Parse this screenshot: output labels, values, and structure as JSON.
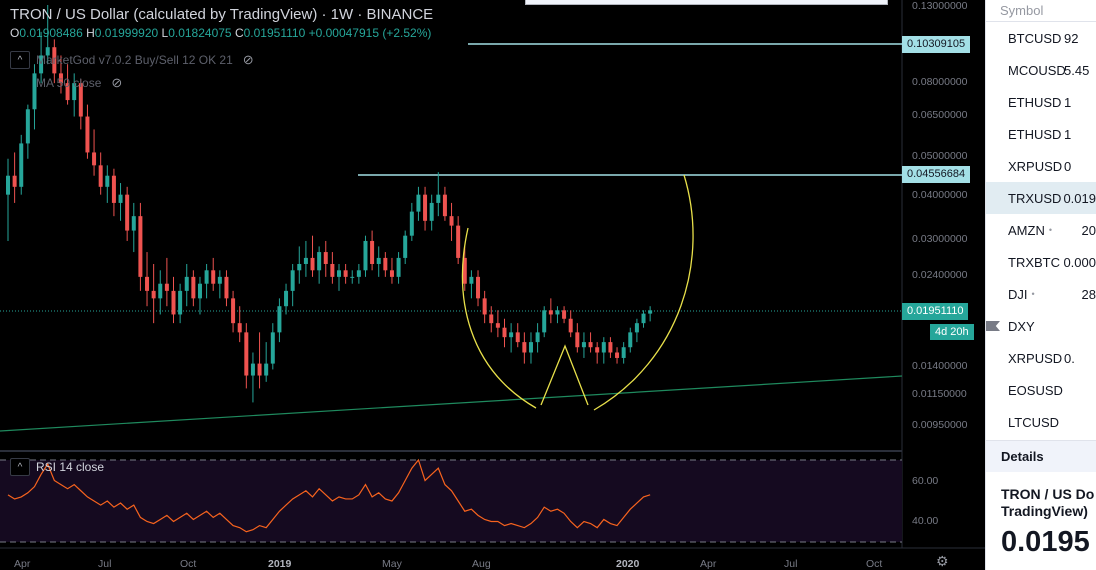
{
  "header": {
    "title": "TRON / US Dollar (calculated by TradingView) · 1W · BINANCE",
    "ohlc": [
      {
        "k": "O",
        "v": "0.01908486"
      },
      {
        "k": "H",
        "v": "0.01999920"
      },
      {
        "k": "L",
        "v": "0.01824075"
      },
      {
        "k": "C",
        "v": "0.01951110"
      },
      {
        "k": "",
        "v": "+0.00047915 (+2.52%)"
      }
    ]
  },
  "indicators": {
    "marketgod": "MarketGod v7.0.2 Buy/Sell 12 OK 21",
    "ma": "MA 50 close",
    "rsi": "RSI 14 close",
    "toggle": "^"
  },
  "price_axis": {
    "labels": [
      "0.13000000",
      "0.08000000",
      "0.06500000",
      "0.05000000",
      "0.04000000",
      "0.03000000",
      "0.02400000",
      "0.01400000",
      "0.01150000",
      "0.00950000"
    ],
    "line_tag_top": "0.10309105",
    "line_tag_mid": "0.04556684",
    "current_price": "0.01951110",
    "countdown": "4d 20h"
  },
  "rsi_axis": [
    "60.00",
    "40.00"
  ],
  "time_axis": [
    "Apr",
    "Jul",
    "Oct",
    "2019",
    "May",
    "Aug",
    "2020",
    "Apr",
    "Jul",
    "Oct"
  ],
  "chart_data": {
    "type": "candlestick",
    "symbol": "TRXUSD",
    "interval": "1W",
    "up_color": "#26a69a",
    "down_color": "#ef5350",
    "candles": [
      [
        0.04,
        0.05,
        0.03,
        0.045
      ],
      [
        0.045,
        0.052,
        0.038,
        0.042
      ],
      [
        0.042,
        0.058,
        0.04,
        0.055
      ],
      [
        0.055,
        0.07,
        0.05,
        0.068
      ],
      [
        0.068,
        0.09,
        0.06,
        0.085
      ],
      [
        0.085,
        0.11,
        0.08,
        0.095
      ],
      [
        0.095,
        0.13,
        0.09,
        0.1
      ],
      [
        0.1,
        0.105,
        0.08,
        0.085
      ],
      [
        0.085,
        0.095,
        0.075,
        0.08
      ],
      [
        0.08,
        0.09,
        0.07,
        0.072
      ],
      [
        0.072,
        0.085,
        0.065,
        0.08
      ],
      [
        0.08,
        0.082,
        0.06,
        0.065
      ],
      [
        0.065,
        0.07,
        0.05,
        0.052
      ],
      [
        0.052,
        0.06,
        0.045,
        0.048
      ],
      [
        0.048,
        0.052,
        0.04,
        0.042
      ],
      [
        0.042,
        0.048,
        0.038,
        0.045
      ],
      [
        0.045,
        0.047,
        0.035,
        0.038
      ],
      [
        0.038,
        0.043,
        0.034,
        0.04
      ],
      [
        0.04,
        0.042,
        0.03,
        0.032
      ],
      [
        0.032,
        0.038,
        0.028,
        0.035
      ],
      [
        0.035,
        0.038,
        0.022,
        0.024
      ],
      [
        0.024,
        0.028,
        0.02,
        0.022
      ],
      [
        0.022,
        0.026,
        0.018,
        0.021
      ],
      [
        0.021,
        0.025,
        0.019,
        0.023
      ],
      [
        0.023,
        0.027,
        0.02,
        0.022
      ],
      [
        0.022,
        0.024,
        0.018,
        0.019
      ],
      [
        0.019,
        0.023,
        0.018,
        0.022
      ],
      [
        0.022,
        0.026,
        0.02,
        0.024
      ],
      [
        0.024,
        0.025,
        0.02,
        0.021
      ],
      [
        0.021,
        0.024,
        0.019,
        0.023
      ],
      [
        0.023,
        0.026,
        0.021,
        0.025
      ],
      [
        0.025,
        0.027,
        0.022,
        0.023
      ],
      [
        0.023,
        0.025,
        0.021,
        0.024
      ],
      [
        0.024,
        0.025,
        0.02,
        0.021
      ],
      [
        0.021,
        0.022,
        0.017,
        0.018
      ],
      [
        0.018,
        0.02,
        0.016,
        0.017
      ],
      [
        0.017,
        0.018,
        0.012,
        0.013
      ],
      [
        0.013,
        0.015,
        0.011,
        0.014
      ],
      [
        0.014,
        0.017,
        0.012,
        0.013
      ],
      [
        0.013,
        0.016,
        0.0125,
        0.014
      ],
      [
        0.014,
        0.018,
        0.0135,
        0.017
      ],
      [
        0.017,
        0.021,
        0.016,
        0.02
      ],
      [
        0.02,
        0.023,
        0.019,
        0.022
      ],
      [
        0.022,
        0.026,
        0.02,
        0.025
      ],
      [
        0.025,
        0.029,
        0.023,
        0.026
      ],
      [
        0.026,
        0.03,
        0.024,
        0.027
      ],
      [
        0.027,
        0.031,
        0.024,
        0.025
      ],
      [
        0.025,
        0.029,
        0.023,
        0.028
      ],
      [
        0.028,
        0.03,
        0.024,
        0.026
      ],
      [
        0.026,
        0.028,
        0.023,
        0.024
      ],
      [
        0.024,
        0.026,
        0.022,
        0.025
      ],
      [
        0.025,
        0.026,
        0.023,
        0.024
      ],
      [
        0.024,
        0.025,
        0.023,
        0.024
      ],
      [
        0.024,
        0.026,
        0.023,
        0.025
      ],
      [
        0.025,
        0.031,
        0.024,
        0.03
      ],
      [
        0.03,
        0.032,
        0.025,
        0.026
      ],
      [
        0.026,
        0.029,
        0.024,
        0.027
      ],
      [
        0.027,
        0.028,
        0.024,
        0.025
      ],
      [
        0.025,
        0.027,
        0.023,
        0.024
      ],
      [
        0.024,
        0.028,
        0.023,
        0.027
      ],
      [
        0.027,
        0.032,
        0.026,
        0.031
      ],
      [
        0.031,
        0.038,
        0.03,
        0.036
      ],
      [
        0.036,
        0.042,
        0.034,
        0.04
      ],
      [
        0.04,
        0.042,
        0.032,
        0.034
      ],
      [
        0.034,
        0.04,
        0.032,
        0.038
      ],
      [
        0.038,
        0.046,
        0.035,
        0.04
      ],
      [
        0.04,
        0.042,
        0.034,
        0.035
      ],
      [
        0.035,
        0.038,
        0.03,
        0.033
      ],
      [
        0.033,
        0.035,
        0.026,
        0.027
      ],
      [
        0.027,
        0.029,
        0.022,
        0.023
      ],
      [
        0.023,
        0.025,
        0.021,
        0.024
      ],
      [
        0.024,
        0.025,
        0.02,
        0.021
      ],
      [
        0.021,
        0.022,
        0.018,
        0.019
      ],
      [
        0.019,
        0.02,
        0.017,
        0.018
      ],
      [
        0.018,
        0.0195,
        0.0165,
        0.0175
      ],
      [
        0.0175,
        0.0185,
        0.0155,
        0.0165
      ],
      [
        0.0165,
        0.018,
        0.015,
        0.017
      ],
      [
        0.017,
        0.018,
        0.0155,
        0.016
      ],
      [
        0.016,
        0.017,
        0.014,
        0.015
      ],
      [
        0.015,
        0.017,
        0.014,
        0.016
      ],
      [
        0.016,
        0.018,
        0.015,
        0.017
      ],
      [
        0.017,
        0.02,
        0.0165,
        0.0195
      ],
      [
        0.0195,
        0.021,
        0.018,
        0.019
      ],
      [
        0.019,
        0.02,
        0.018,
        0.0195
      ],
      [
        0.0195,
        0.02,
        0.018,
        0.0185
      ],
      [
        0.0185,
        0.0195,
        0.0165,
        0.017
      ],
      [
        0.017,
        0.018,
        0.015,
        0.0155
      ],
      [
        0.0155,
        0.017,
        0.0145,
        0.016
      ],
      [
        0.016,
        0.017,
        0.015,
        0.0155
      ],
      [
        0.0155,
        0.016,
        0.014,
        0.015
      ],
      [
        0.015,
        0.0165,
        0.014,
        0.016
      ],
      [
        0.016,
        0.0165,
        0.0145,
        0.015
      ],
      [
        0.015,
        0.0155,
        0.014,
        0.0145
      ],
      [
        0.0145,
        0.016,
        0.014,
        0.0155
      ],
      [
        0.0155,
        0.0175,
        0.015,
        0.017
      ],
      [
        0.017,
        0.0185,
        0.016,
        0.018
      ],
      [
        0.018,
        0.0195,
        0.0175,
        0.0191
      ],
      [
        0.0191,
        0.02,
        0.0182,
        0.0195
      ]
    ],
    "rsi": [
      53,
      51,
      52,
      54,
      57,
      63,
      68,
      60,
      58,
      56,
      58,
      55,
      52,
      50,
      48,
      50,
      47,
      49,
      46,
      48,
      42,
      40,
      39,
      41,
      43,
      40,
      42,
      44,
      41,
      43,
      45,
      42,
      44,
      41,
      38,
      37,
      35,
      36,
      38,
      37,
      41,
      45,
      48,
      51,
      53,
      55,
      52,
      56,
      53,
      50,
      52,
      51,
      51,
      53,
      58,
      52,
      54,
      51,
      50,
      54,
      60,
      66,
      70,
      60,
      63,
      66,
      58,
      55,
      50,
      45,
      46,
      43,
      41,
      40,
      40,
      38,
      39,
      38,
      37,
      39,
      42,
      47,
      45,
      46,
      44,
      40,
      37,
      40,
      39,
      37,
      41,
      39,
      38,
      42,
      46,
      49,
      52,
      53
    ],
    "ma50_label": "MA 50 close",
    "rsi_range": [
      30,
      70
    ],
    "rsi_bands": [
      70,
      30
    ]
  },
  "watchlist": {
    "header": "Symbol",
    "rows": [
      {
        "sym": "BTCUSD",
        "val": "92",
        "dot": ""
      },
      {
        "sym": "MCOUSD",
        "val": "5.45",
        "dot": ""
      },
      {
        "sym": "ETHUSD",
        "val": "1",
        "dot": ""
      },
      {
        "sym": "ETHUSD",
        "val": "1",
        "dot": ""
      },
      {
        "sym": "XRPUSD",
        "val": "0",
        "dot": ""
      },
      {
        "sym": "TRXUSD",
        "val": "0.019",
        "dot": ""
      },
      {
        "sym": "AMZN",
        "val": "20",
        "dot": "•"
      },
      {
        "sym": "TRXBTC",
        "val": "0.000",
        "dot": ""
      },
      {
        "sym": "DJI",
        "val": "28",
        "dot": "•"
      },
      {
        "sym": "DXY",
        "val": "",
        "dot": ""
      },
      {
        "sym": "XRPUSD",
        "val": "0.",
        "dot": ""
      },
      {
        "sym": "EOSUSD",
        "val": "",
        "dot": ""
      },
      {
        "sym": "LTCUSD",
        "val": "",
        "dot": ""
      }
    ],
    "details_label": "Details",
    "details_name_1": "TRON / US Do",
    "details_name_2": "TradingView)",
    "details_price": "0.0195"
  }
}
